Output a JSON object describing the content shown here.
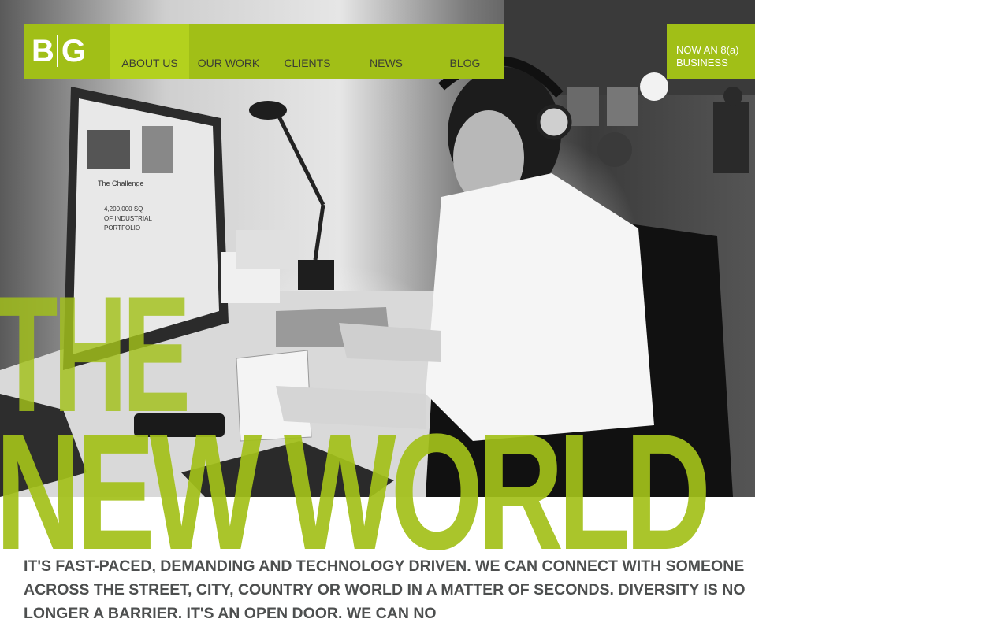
{
  "nav": {
    "logo": {
      "left": "B",
      "right": "G"
    },
    "items": [
      {
        "label": "ABOUT US",
        "active": true
      },
      {
        "label": "OUR WORK",
        "active": false
      },
      {
        "label": "CLIENTS",
        "active": false
      },
      {
        "label": "NEWS",
        "active": false
      },
      {
        "label": "BLOG",
        "active": false
      }
    ]
  },
  "badge": {
    "line1": "NOW AN 8(a)",
    "line2": "BUSINESS"
  },
  "hero": {
    "headline_line1": "THE",
    "headline_line2": "NEW WORLD",
    "screen_text": [
      "The Challenge",
      "4,200,000 SQ",
      "OF INDUSTRIAL",
      "PORTFOLIO"
    ]
  },
  "intro": {
    "text": "IT'S FAST-PACED, DEMANDING AND TECHNOLOGY DRIVEN. WE CAN CONNECT WITH SOMEONE ACROSS THE STREET, CITY, COUNTRY OR WORLD IN A MATTER OF SECONDS. DIVERSITY IS NO LONGER A BARRIER. IT'S AN OPEN DOOR. WE CAN NO"
  },
  "colors": {
    "accent": "#a1bf17",
    "accent_light": "#b3d11e",
    "headline": "#a3c11a",
    "text": "#4d4f4f"
  }
}
